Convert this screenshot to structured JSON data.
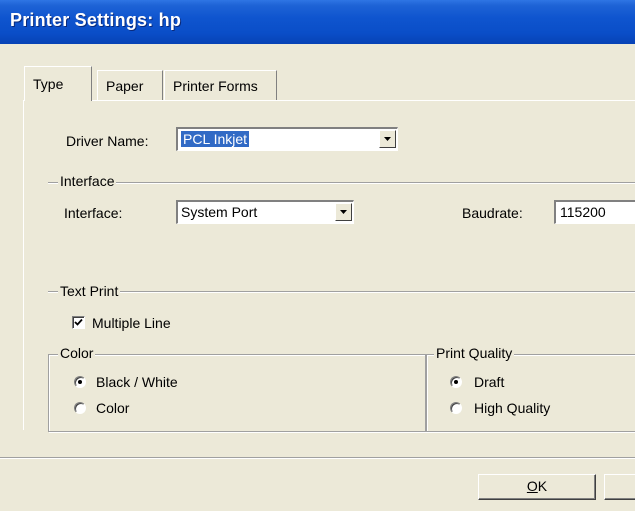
{
  "window": {
    "title": "Printer Settings: hp"
  },
  "tabs": [
    {
      "label": "Type",
      "selected": true
    },
    {
      "label": "Paper",
      "selected": false
    },
    {
      "label": "Printer Forms",
      "selected": false
    }
  ],
  "driver": {
    "label": "Driver Name:",
    "value": "PCL Inkjet"
  },
  "interface_group": {
    "title": "Interface",
    "interface_label": "Interface:",
    "interface_value": "System Port",
    "baudrate_label": "Baudrate:",
    "baudrate_value": "115200"
  },
  "text_print": {
    "title": "Text Print",
    "multiple_line_label": "Multiple Line",
    "multiple_line_checked": true
  },
  "color_group": {
    "title": "Color",
    "options": [
      {
        "label": "Black / White",
        "selected": true
      },
      {
        "label": "Color",
        "selected": false
      }
    ]
  },
  "quality_group": {
    "title": "Print Quality",
    "options": [
      {
        "label": "Draft",
        "selected": true
      },
      {
        "label": "High Quality",
        "selected": false
      }
    ]
  },
  "buttons": {
    "ok_prefix": "",
    "ok_mnemonic": "O",
    "ok_suffix": "K"
  },
  "icons": {
    "dropdown": "chevron-down-icon",
    "checkmark": "checkmark-icon"
  }
}
